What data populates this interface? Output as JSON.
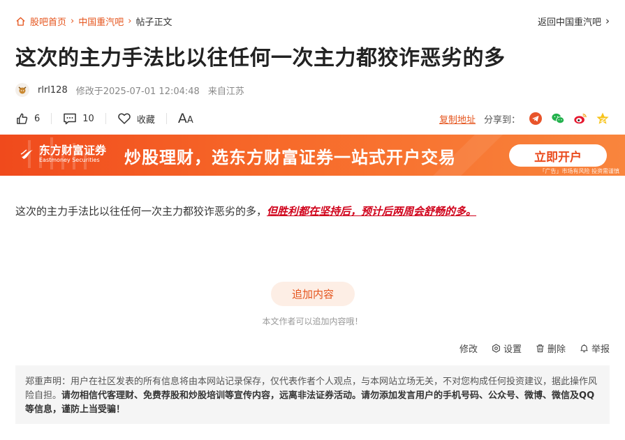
{
  "breadcrumb": {
    "home": "股吧首页",
    "forum": "中国重汽吧",
    "current": "帖子正文",
    "back": "返回中国重汽吧"
  },
  "post": {
    "title": "这次的主力手法比以往任何一次主力都狡诈恶劣的多",
    "author": "rlrl128",
    "modified": "修改于2025-07-01 12:04:48",
    "location": "来自江苏",
    "content_plain": "这次的主力手法比以往任何一次主力都狡诈恶劣的多，",
    "content_emphasis": "但胜利都在坚持后，预计后两周会舒畅的多。"
  },
  "actions": {
    "likes": "6",
    "comments": "10",
    "favorite": "收藏",
    "font_big": "A",
    "font_small": "A",
    "copy_link": "复制地址",
    "share_label": "分享到："
  },
  "banner": {
    "logo_cn": "东方财富证券",
    "logo_en": "Eastmoney Securities",
    "slogan": "炒股理财，选东方财富证券一站式开户交易",
    "button": "立即开户",
    "note": "「广告」市场有风险 投资需谨慎"
  },
  "add_content": {
    "button": "追加内容",
    "hint": "本文作者可以追加内容哦！"
  },
  "ops": {
    "edit": "修改",
    "settings": "设置",
    "delete": "删除",
    "report": "举报"
  },
  "notice": {
    "normal": "郑重声明：用户在社区发表的所有信息将由本网站记录保存，仅代表作者个人观点，与本网站立场无关，不对您构成任何投资建议，据此操作风险自担。",
    "bold": "请勿相信代客理财、免费荐股和炒股培训等宣传内容，远离非法证券活动。请勿添加发言用户的手机号码、公众号、微博、微信及QQ等信息，谨防上当受骗！"
  },
  "colors": {
    "accent": "#e5541c",
    "emphasis": "#d0021b",
    "banner_start": "#f04a1c",
    "banner_end": "#f9853d"
  },
  "icons": {
    "home": "home-icon",
    "back": "chevron-right-icon",
    "like": "thumb-up-icon",
    "comment": "comment-icon",
    "favorite": "heart-icon",
    "font": "font-size-icon",
    "share": [
      "telegram-icon",
      "wechat-icon",
      "weibo-icon",
      "qzone-star-icon"
    ],
    "ops": [
      "settings-gear-icon",
      "trash-icon",
      "report-bell-icon"
    ]
  }
}
